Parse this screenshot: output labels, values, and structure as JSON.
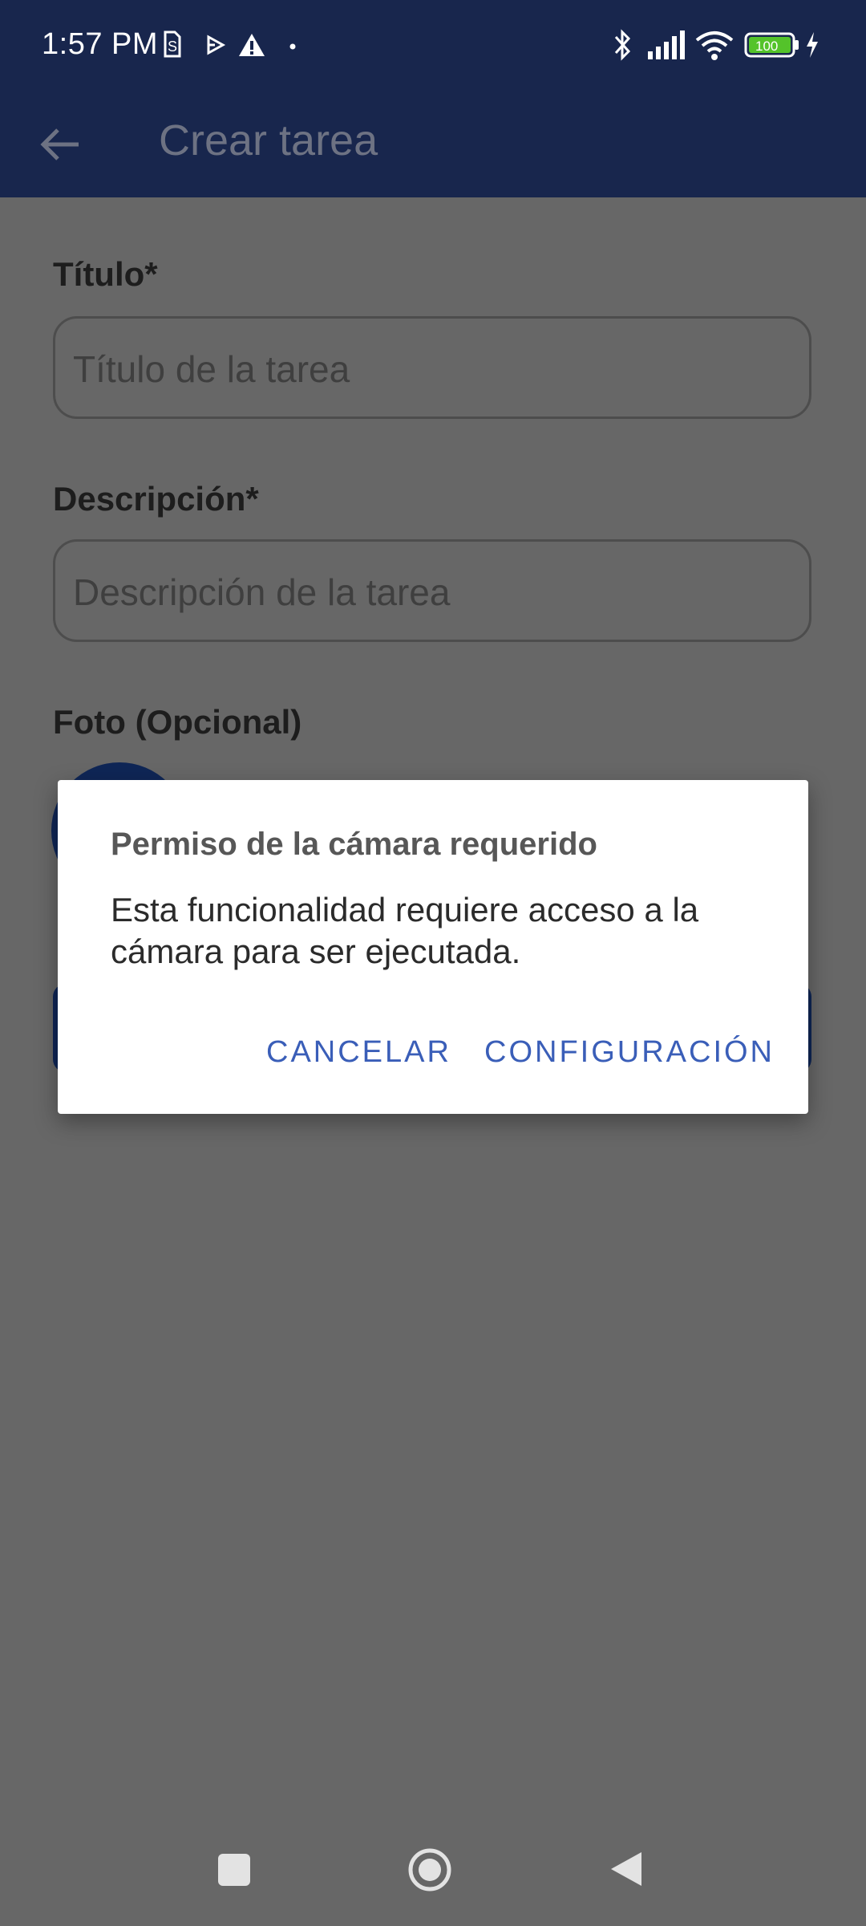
{
  "status_bar": {
    "time": "1:57 PM",
    "battery": "100",
    "icons": [
      "sim-icon",
      "play-icon",
      "warning-icon",
      "dot-icon",
      "bluetooth-icon",
      "signal-icon",
      "wifi-icon",
      "battery-icon",
      "charging-icon"
    ]
  },
  "app_bar": {
    "back_icon": "arrow-left-icon",
    "title": "Crear tarea"
  },
  "form": {
    "title_label": "Título*",
    "title_placeholder": "Título de la tarea",
    "description_label": "Descripción*",
    "description_placeholder": "Descripción de la tarea",
    "photo_label": "Foto (Opcional)"
  },
  "dialog": {
    "title": "Permiso de la cámara requerido",
    "message": "Esta funcionalidad requiere acceso a la cámara para ser ejecutada.",
    "cancel_label": "CANCELAR",
    "settings_label": "CONFIGURACIÓN"
  },
  "nav_bar": {
    "icons": [
      "recents-square-icon",
      "home-circle-icon",
      "back-triangle-icon"
    ]
  },
  "colors": {
    "header": "#18264d",
    "scrim_bg": "#676767",
    "accent": "#3a5eb8",
    "primary_dark": "#0f2656"
  }
}
